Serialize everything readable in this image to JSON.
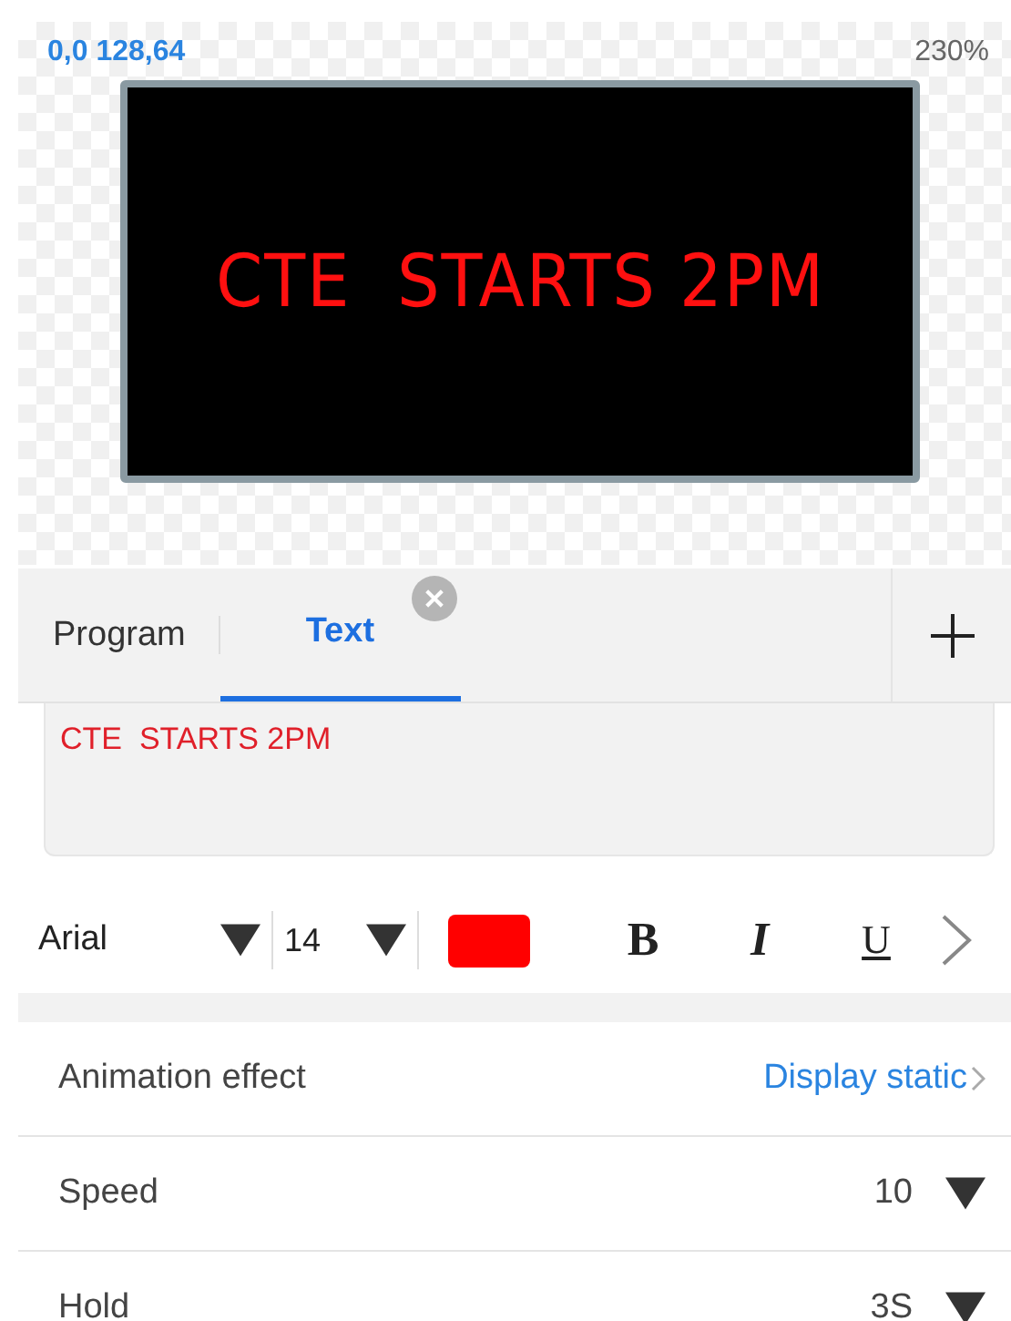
{
  "canvas": {
    "coordinates": "0,0 128,64",
    "zoom": "230%",
    "display_text": "CTE  STARTS 2PM"
  },
  "tabs": [
    {
      "label": "Program",
      "selected": false
    },
    {
      "label": "Text",
      "selected": true
    }
  ],
  "text_input": {
    "value": "CTE  STARTS 2PM"
  },
  "toolbar": {
    "font": "Arial",
    "size": "14",
    "color": "#ff0000",
    "bold": "B",
    "italic": "I",
    "underline": "U"
  },
  "settings": [
    {
      "label": "Animation effect",
      "value": "Display static",
      "kind": "link"
    },
    {
      "label": "Speed",
      "value": "10",
      "kind": "dropdown"
    },
    {
      "label": "Hold",
      "value": "3S",
      "kind": "dropdown"
    }
  ]
}
